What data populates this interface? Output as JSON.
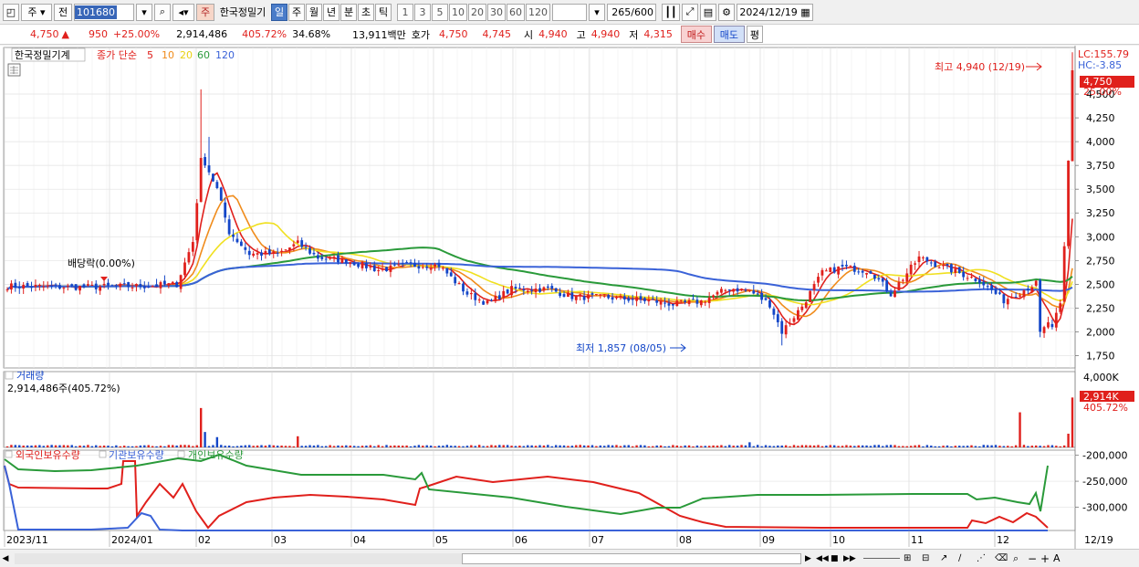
{
  "toolbar": {
    "market_label": "주",
    "prev_label": "전",
    "code_value": "101680",
    "stock_name": "한국정밀기",
    "name_badge": "주",
    "periods": [
      "일",
      "주",
      "월",
      "년",
      "분",
      "초",
      "틱"
    ],
    "active_period": "일",
    "intervals": [
      "1",
      "3",
      "5",
      "10",
      "20",
      "30",
      "60",
      "120"
    ],
    "count_value": "265",
    "count_max": "/600",
    "date_value": "2024/12/19"
  },
  "quote": {
    "price": "4,750",
    "arrow": "▲",
    "change": "950",
    "change_pct": "+25.00%",
    "volume": "2,914,486",
    "volume_ratio": "405.72%",
    "turnover": "34.68%",
    "amount": "13,911백만",
    "bid_label": "호가",
    "bid1": "4,750",
    "bid2": "4,745",
    "open_label": "시",
    "open": "4,940",
    "high_label": "고",
    "high": "4,940",
    "low_label": "저",
    "low": "4,315",
    "buy_button": "매수",
    "sell_button": "매도",
    "eval_button": "평"
  },
  "main_panel": {
    "title": "한국정밀기계",
    "indicator_label": "종가 단순",
    "ma_labels": [
      "5",
      "10",
      "20",
      "60",
      "120"
    ],
    "ma_colors": [
      "#e0201c",
      "#f08c1c",
      "#f0e020",
      "#2a9a3a",
      "#3a62d8"
    ],
    "lc_label": "LC:155.79",
    "hc_label": "HC:-3.85",
    "high_annotation": "최고 4,940 (12/19)",
    "low_annotation": "최저 1,857 (08/05)",
    "dividend_annotation": "배당락(0.00%)",
    "price_tag": "4,750",
    "pct_tag": "25.00%",
    "y_ticks": [
      "4,500",
      "4,250",
      "4,000",
      "3,750",
      "3,500",
      "3,250",
      "3,000",
      "2,750",
      "2,500",
      "2,250",
      "2,000",
      "1,750"
    ]
  },
  "volume_panel": {
    "title": "거래량",
    "value_label": "2,914,486주(405.72%)",
    "y_top": "4,000K",
    "tag_value": "2,914K",
    "tag_pct": "405.72%"
  },
  "holder_panel": {
    "series_labels": [
      "외국인보유수량",
      "기관보유수량",
      "개인보유수량"
    ],
    "series_colors": [
      "#e0201c",
      "#3a62d8",
      "#2a9a3a"
    ],
    "y_ticks": [
      "-200,000",
      "-250,000",
      "-300,000"
    ]
  },
  "x_axis": {
    "labels": [
      "2023/11",
      "2024/01",
      "02",
      "03",
      "04",
      "05",
      "06",
      "07",
      "08",
      "09",
      "10",
      "11",
      "12"
    ],
    "right_label": "12/19"
  },
  "colors": {
    "up": "#e0201c",
    "down": "#1346c8",
    "grid": "#dcdcdc"
  }
}
